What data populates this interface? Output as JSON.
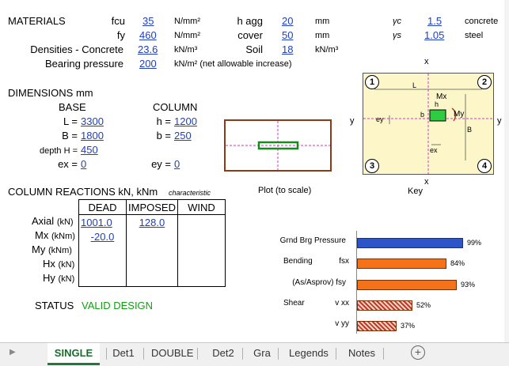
{
  "materials": {
    "title": "MATERIALS",
    "fcu_label": "fcu",
    "fcu_value": "35",
    "fcu_unit": "N/mm²",
    "fy_label": "fy",
    "fy_value": "460",
    "fy_unit": "N/mm²",
    "hagg_label": "h agg",
    "hagg_value": "20",
    "hagg_unit": "mm",
    "cover_label": "cover",
    "cover_value": "50",
    "cover_unit": "mm",
    "gc_label": "γc",
    "gc_value": "1.5",
    "gc_text": "concrete",
    "gs_label": "γs",
    "gs_value": "1.05",
    "gs_text": "steel",
    "dens_label": "Densities - Concrete",
    "dens_value": "23.6",
    "dens_unit": "kN/m³",
    "soil_label": "Soil",
    "soil_value": "18",
    "soil_unit": "kN/m³",
    "bear_label": "Bearing pressure",
    "bear_value": "200",
    "bear_unit": "kN/m² (net allowable increase)"
  },
  "dimensions": {
    "title": "DIMENSIONS mm",
    "base_heading": "BASE",
    "column_heading": "COLUMN",
    "L_label": "L =",
    "L_value": "3300",
    "B_label": "B =",
    "B_value": "1800",
    "H_label": "depth H =",
    "H_value": "450",
    "ex_label": "ex =",
    "ex_value": "0",
    "h_label": "h =",
    "h_value": "1200",
    "b_label": "b =",
    "b_value": "250",
    "ey_label": "ey =",
    "ey_value": "0"
  },
  "reactions": {
    "title": "COLUMN REACTIONS kN, kNm",
    "subtitle": "characteristic",
    "headers": [
      "DEAD",
      "IMPOSED",
      "WIND"
    ],
    "rows": [
      {
        "label": "Axial",
        "unit": "(kN)",
        "dead": "1001.0",
        "imposed": "128.0",
        "wind": ""
      },
      {
        "label": "Mx",
        "unit": "(kNm)",
        "dead": "-20.0",
        "imposed": "",
        "wind": ""
      },
      {
        "label": "My",
        "unit": "(kNm)",
        "dead": "",
        "imposed": "",
        "wind": ""
      },
      {
        "label": "Hx",
        "unit": "(kN)",
        "dead": "",
        "imposed": "",
        "wind": ""
      },
      {
        "label": "Hy",
        "unit": "(kN)",
        "dead": "",
        "imposed": "",
        "wind": ""
      }
    ]
  },
  "plot": {
    "caption": "Plot  (to scale)"
  },
  "key": {
    "caption": "Key",
    "corners": [
      "1",
      "2",
      "3",
      "4"
    ],
    "x_label": "x",
    "y_label": "y",
    "L": "L",
    "B": "B",
    "Mx": "Mx",
    "My": "My",
    "ey": "ey",
    "ex": "ex",
    "b": "b",
    "h": "h"
  },
  "status": {
    "label": "STATUS",
    "value": "VALID DESIGN"
  },
  "utilisation": {
    "bars": [
      {
        "label": "Grnd Brg Pressure",
        "sub": "",
        "value": 0.99,
        "text": "99%",
        "style": "blue2"
      },
      {
        "label": "Bending",
        "sub": "fsx",
        "value": 0.84,
        "text": "84%",
        "style": "solid"
      },
      {
        "label": "(As/Asprov) fsy",
        "sub": "",
        "value": 0.93,
        "text": "93%",
        "style": "solid"
      },
      {
        "label": "Shear",
        "sub": "v xx",
        "value": 0.52,
        "text": "52%",
        "style": "hatch"
      },
      {
        "label": "",
        "sub": "v yy",
        "value": 0.37,
        "text": "37%",
        "style": "hatch"
      }
    ]
  },
  "tabs": [
    "SINGLE",
    "Det1",
    "DOUBLE",
    "Det2",
    "Gra",
    "Legends",
    "Notes"
  ],
  "active_tab": "SINGLE",
  "colors": {
    "accent_green": "#12a012",
    "link_blue": "#1f3fbf",
    "orange": "#f47319"
  }
}
